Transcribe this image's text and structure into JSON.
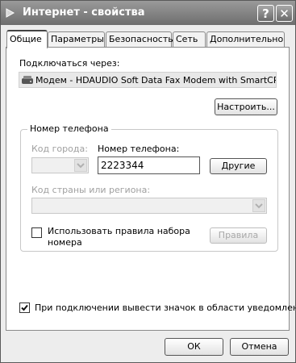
{
  "window": {
    "title": "Интернет - свойства",
    "help_label": "?",
    "close_label": "✕"
  },
  "tabs": [
    {
      "label": "Общие"
    },
    {
      "label": "Параметры"
    },
    {
      "label": "Безопасность"
    },
    {
      "label": "Сеть"
    },
    {
      "label": "Дополнительно"
    }
  ],
  "general": {
    "connect_via_label": "Подключаться через:",
    "device": "Модем - HDAUDIO Soft Data Fax Modem with SmartCP (COM",
    "configure_label": "Настроить..."
  },
  "phone": {
    "group_title": "Номер телефона",
    "area_code_label": "Код города:",
    "area_code_value": "",
    "phone_label": "Номер телефона:",
    "phone_value": "2223344",
    "other_label": "Другие",
    "country_label": "Код страны или региона:",
    "country_value": "",
    "use_dialing_rules_label_line1": "Использовать правила набора",
    "use_dialing_rules_label_line2": "номера",
    "use_dialing_rules_checked": false,
    "rules_label": "Правила"
  },
  "notify": {
    "label": "При подключении вывести значок в области уведомлений",
    "checked": true
  },
  "footer": {
    "ok_label": "ОК",
    "cancel_label": "Отмена"
  }
}
